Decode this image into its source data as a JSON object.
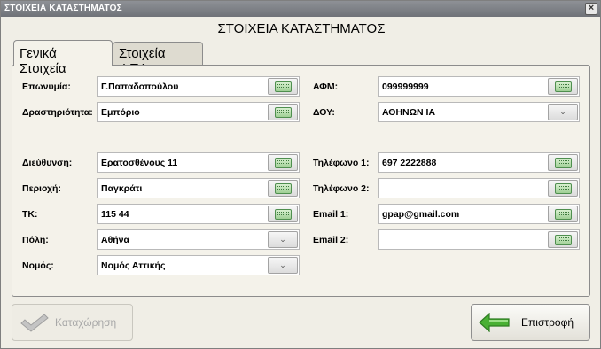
{
  "window": {
    "title": "ΣΤΟΙΧΕΙΑ ΚΑΤΑΣΤΗΜΑΤΟΣ",
    "close_glyph": "×"
  },
  "heading": "ΣΤΟΙΧΕΙΑ ΚΑΤΑΣΤΗΜΑΤΟΣ",
  "tabs": [
    {
      "label": "Γενικά Στοιχεία",
      "active": true
    },
    {
      "label": "Στοιχεία ΦΠΑ",
      "active": false
    }
  ],
  "form": {
    "eponymia": {
      "label": "Επωνυμία:",
      "value": "Γ.Παπαδοπούλου"
    },
    "drastiriotita": {
      "label": "Δραστηριότητα:",
      "value": "Εμπόριο"
    },
    "dieuthinsi": {
      "label": "Διεύθυνση:",
      "value": "Ερατοσθένους 11"
    },
    "perioxi": {
      "label": "Περιοχή:",
      "value": "Παγκράτι"
    },
    "tk": {
      "label": "ΤΚ:",
      "value": "115 44"
    },
    "poli": {
      "label": "Πόλη:",
      "value": "Αθήνα"
    },
    "nomos": {
      "label": "Νομός:",
      "value": "Νομός Αττικής"
    },
    "afm": {
      "label": "ΑΦΜ:",
      "value": "099999999"
    },
    "doy": {
      "label": "ΔΟΥ:",
      "value": "ΑΘΗΝΩΝ ΙΑ"
    },
    "tel1": {
      "label": "Τηλέφωνο 1:",
      "value": "697 2222888"
    },
    "tel2": {
      "label": "Τηλέφωνο 2:",
      "value": ""
    },
    "email1": {
      "label": "Email 1:",
      "value": "gpap@gmail.com"
    },
    "email2": {
      "label": "Email 2:",
      "value": ""
    }
  },
  "icons": {
    "keyboard": "keyboard-icon",
    "dropdown": "chevron-down-icon",
    "check": "checkmark-icon",
    "back": "arrow-left-icon"
  },
  "colors": {
    "accent_green": "#3f9f2f",
    "disabled_text": "#a8a8a8"
  },
  "buttons": {
    "save": {
      "label": "Καταχώρηση",
      "enabled": false
    },
    "back": {
      "label": "Επιστροφή"
    }
  }
}
